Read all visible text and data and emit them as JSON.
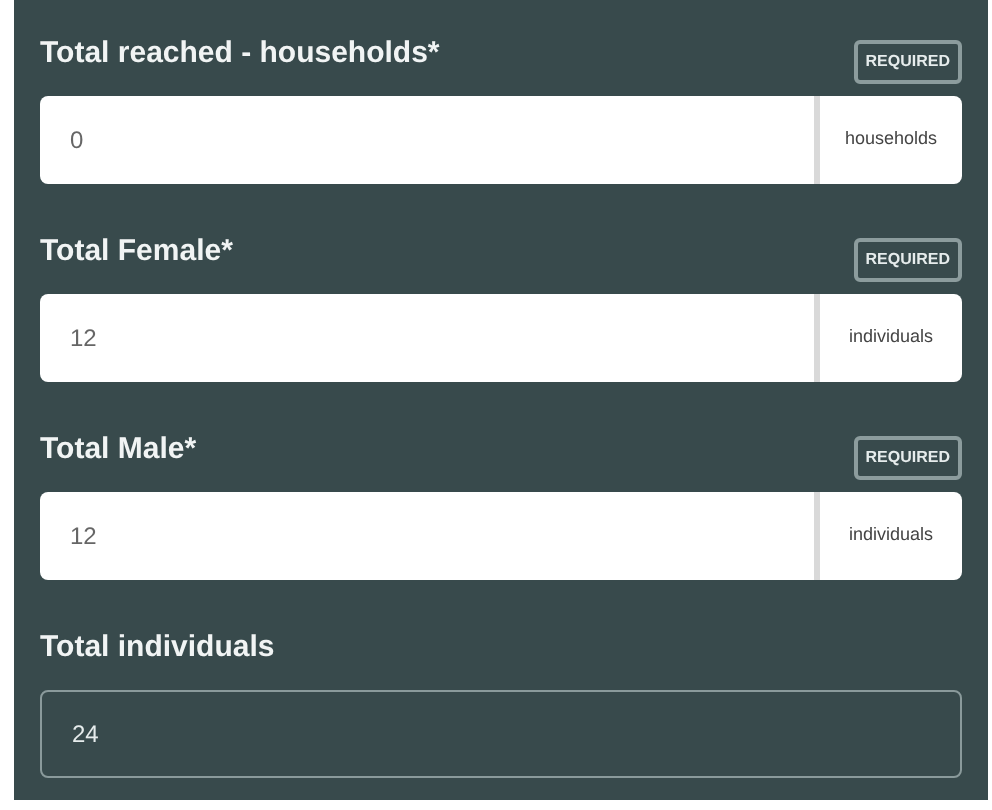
{
  "fields": [
    {
      "kind": "unit",
      "label": "Total reached - households*",
      "required": true,
      "badge": "REQUIRED",
      "value": "0",
      "unit": "households"
    },
    {
      "kind": "unit",
      "label": "Total Female*",
      "required": true,
      "badge": "REQUIRED",
      "value": "12",
      "unit": "individuals"
    },
    {
      "kind": "unit",
      "label": "Total Male*",
      "required": true,
      "badge": "REQUIRED",
      "value": "12",
      "unit": "individuals"
    },
    {
      "kind": "readonly",
      "label": "Total individuals",
      "required": false,
      "value": "24"
    }
  ]
}
